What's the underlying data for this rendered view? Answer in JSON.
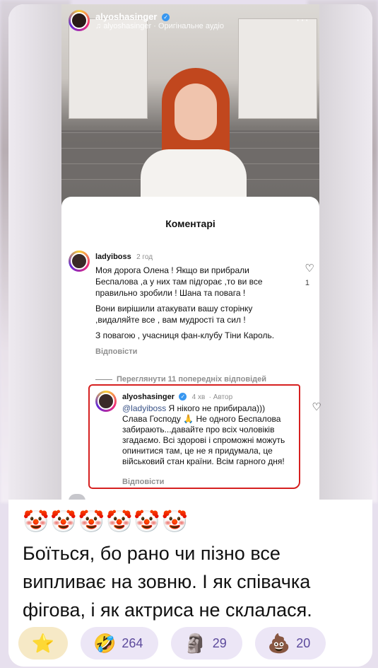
{
  "post": {
    "username": "alyoshasinger",
    "audio_line": "alyoshasinger · Оригінальне аудіо",
    "menu_glyph": "···",
    "verified_glyph": "✓"
  },
  "comments_panel": {
    "title": "Коментарі",
    "comment1": {
      "username": "ladyiboss",
      "time": "2 год",
      "p1": "Моя дорога Олена ! Якщо ви прибрали Беспалова ,а у них там підгорає ,то ви все правильно зробили ! Шана та повага !",
      "p2": "Вони вирішили атакувати вашу сторінку ,видаляйте все , вам мудрості та сил !",
      "p3": "З повагою , учасниця фан-клубу Тіни Кароль.",
      "reply": "Відповісти",
      "likes": "1"
    },
    "view_replies": "Переглянути 11 попередніх відповідей",
    "comment2": {
      "username": "alyoshasinger",
      "time": "4 хв",
      "author_tag": "· Автор",
      "mention": "@ladyiboss",
      "text": " Я нікого не прибирала))) Слава Господу 🙏 Не одного Беспалова забирають...давайте про всіх чоловіків згадаємо. Всі здорові і спроможні можуть опинитися там, це не я придумала, це військовий стан країни. Всім гарного дня!",
      "reply": "Відповісти"
    },
    "heart_glyph": "♡"
  },
  "message": {
    "emoji_row": "🤡🤡🤡🤡🤡🤡",
    "text": "Боїться, бо рано чи пізно все випливає на зовню. І як співачка фігова, і як актриса не склалася."
  },
  "reactions": [
    {
      "emoji": "⭐",
      "count": ""
    },
    {
      "emoji": "🤣",
      "count": "264"
    },
    {
      "emoji": "🗿",
      "count": "29"
    },
    {
      "emoji": "💩",
      "count": "20"
    }
  ],
  "colors": {
    "highlight_border": "#d62020",
    "reaction_bg": "#ece6f6",
    "reaction_text": "#5c4a9c",
    "mention": "#385185"
  }
}
